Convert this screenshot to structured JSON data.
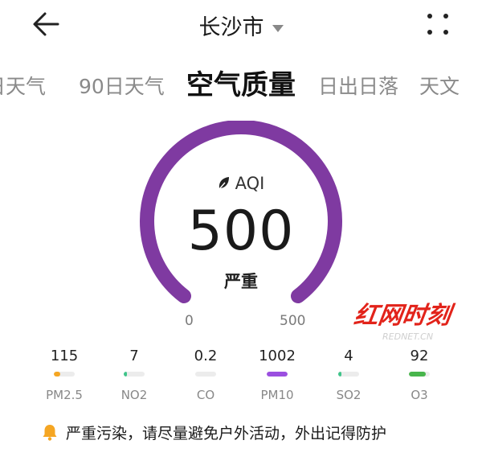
{
  "header": {
    "city": "长沙市"
  },
  "tabs": [
    {
      "label": "日天气"
    },
    {
      "label": "90日天气"
    },
    {
      "label": "空气质量"
    },
    {
      "label": "日出日落"
    },
    {
      "label": "天文"
    }
  ],
  "active_tab": "空气质量",
  "aqi": {
    "label": "AQI",
    "value": "500",
    "level": "严重",
    "scale_min": "0",
    "scale_max": "500",
    "fill_fraction": 1.0,
    "color": "#7f3aa1"
  },
  "pollutants": [
    {
      "value": "115",
      "name": "PM2.5",
      "level_fraction": 0.3,
      "color": "#f5a623"
    },
    {
      "value": "7",
      "name": "NO2",
      "level_fraction": 0.05,
      "color": "#3fc48a"
    },
    {
      "value": "0.2",
      "name": "CO",
      "level_fraction": 0.0,
      "color": "#3fc48a"
    },
    {
      "value": "1002",
      "name": "PM10",
      "level_fraction": 1.0,
      "color": "#9b4fe0"
    },
    {
      "value": "4",
      "name": "SO2",
      "level_fraction": 0.05,
      "color": "#3fc48a"
    },
    {
      "value": "92",
      "name": "O3",
      "level_fraction": 0.8,
      "color": "#48b54c"
    }
  ],
  "advice": "严重污染，请尽量避免户外活动，外出记得防护",
  "watermark": {
    "main": "红网时刻",
    "sub": "REDNET.CN"
  }
}
